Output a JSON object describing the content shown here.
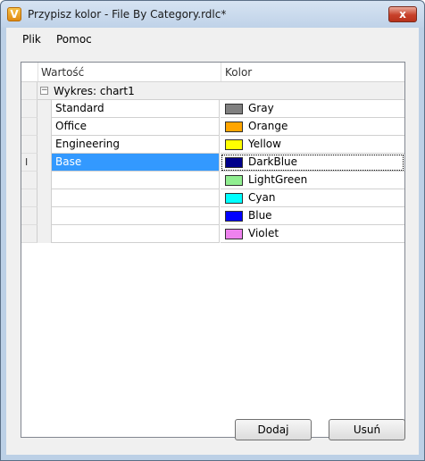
{
  "window": {
    "title": "Przypisz kolor - File By Category.rdlc*",
    "app_icon_letter": "V",
    "close_glyph": "x"
  },
  "menu": {
    "items": [
      {
        "label": "Plik"
      },
      {
        "label": "Pomoc"
      }
    ]
  },
  "grid": {
    "headers": {
      "value": "Wartość",
      "color": "Kolor"
    },
    "group": {
      "label": "Wykres: chart1",
      "expander": "−"
    },
    "rows": [
      {
        "value": "Standard",
        "color": "Gray",
        "swatch": "#808080"
      },
      {
        "value": "Office",
        "color": "Orange",
        "swatch": "#ffa500"
      },
      {
        "value": "Engineering",
        "color": "Yellow",
        "swatch": "#ffff00"
      },
      {
        "value": "Base",
        "color": "DarkBlue",
        "swatch": "#00008b",
        "selected": true
      },
      {
        "value": "",
        "color": "LightGreen",
        "swatch": "#90ee90"
      },
      {
        "value": "",
        "color": "Cyan",
        "swatch": "#00ffff"
      },
      {
        "value": "",
        "color": "Blue",
        "swatch": "#0000ff"
      },
      {
        "value": "",
        "color": "Violet",
        "swatch": "#ee82ee"
      }
    ],
    "selection_color": "#3399ff",
    "edit_cursor_glyph": "I"
  },
  "buttons": {
    "add_label": "Dodaj",
    "remove_label": "Usuń"
  }
}
